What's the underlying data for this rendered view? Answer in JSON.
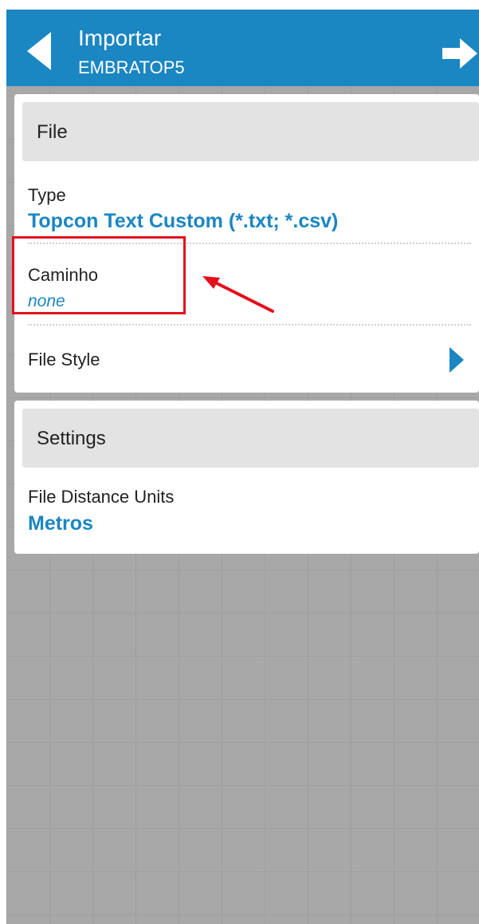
{
  "header": {
    "title": "Importar",
    "subtitle": "EMBRATOP5",
    "back_icon": "triangle-left-icon",
    "next_icon": "arrow-right-icon",
    "bar_color": "#1a86c2"
  },
  "file_section": {
    "heading": "File",
    "type_label": "Type",
    "type_value": "Topcon Text Custom (*.txt; *.csv)",
    "path_label": "Caminho",
    "path_value": "none",
    "style_label": "File Style",
    "style_icon": "chevron-right-icon"
  },
  "settings_section": {
    "heading": "Settings",
    "units_label": "File Distance Units",
    "units_value": "Metros"
  },
  "annotation": {
    "box_color": "#e3101c",
    "arrow_color": "#e3101c"
  }
}
